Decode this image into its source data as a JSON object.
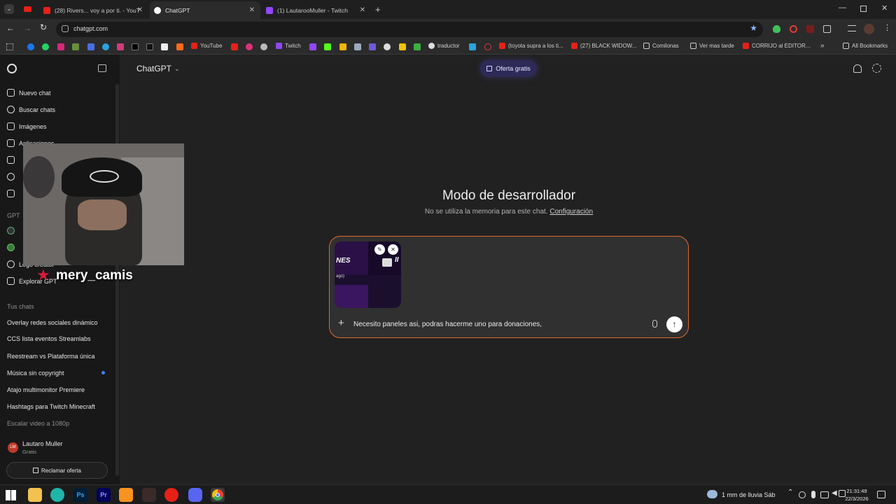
{
  "browser": {
    "tabs": [
      {
        "title": "(28) Rivers... voy a por ti. - YouT"
      },
      {
        "title": "ChatGPT"
      },
      {
        "title": "(1) LautarooMuller - Twitch"
      }
    ],
    "url": "chatgpt.com",
    "bookmarks": [
      "YouTube",
      "Twitch",
      "traductor",
      "(toyota supra a los ti...",
      "(27) BLACK WIDOW...",
      "Comilonas",
      "Ver mas tarde",
      "CORRIJO al EDITOR..."
    ],
    "all_bookmarks": "All Bookmarks"
  },
  "sidebar": {
    "items": [
      {
        "label": "Nuevo chat"
      },
      {
        "label": "Buscar chats"
      },
      {
        "label": "Imágenes"
      },
      {
        "label": "Aplicaciones"
      },
      {
        "label": "Logo creator"
      },
      {
        "label": "Explorar GPT"
      }
    ],
    "gpt_section": "GPT",
    "chats_section": "Tus chats",
    "chats": [
      "Overlay redes sociales dinámico",
      "CCS lista eventos Streamlabs",
      "Reestream vs Plataforma única",
      "Música sin copyright",
      "Atajo multimonitor Premiere",
      "Hashtags para Twitch Minecraft",
      "Escalar video a 1080p"
    ],
    "user": {
      "initials": "LM",
      "name": "Lautaro Muller",
      "plan": "Gratis"
    },
    "claim_button": "Reclamar oferta"
  },
  "header": {
    "model": "ChatGPT",
    "offer": "Oferta gratis"
  },
  "main": {
    "title": "Modo de desarrollador",
    "subtitle": "No se utiliza la memoria para este chat.",
    "config_link": "Configuración"
  },
  "composer": {
    "attachment_text_1": "NES",
    "attachment_text_2": "ago)",
    "input_value": "Necesito paneles asi, podras hacerme uno para donaciones,"
  },
  "overlay": {
    "username": "mery_camis"
  },
  "taskbar": {
    "weather": "1 mm de lluvia Sáb",
    "time": "21:31:49",
    "date": "22/3/2026"
  },
  "colors": {
    "accent_border": "#e0692f",
    "offer_bg": "#2d2a58"
  }
}
